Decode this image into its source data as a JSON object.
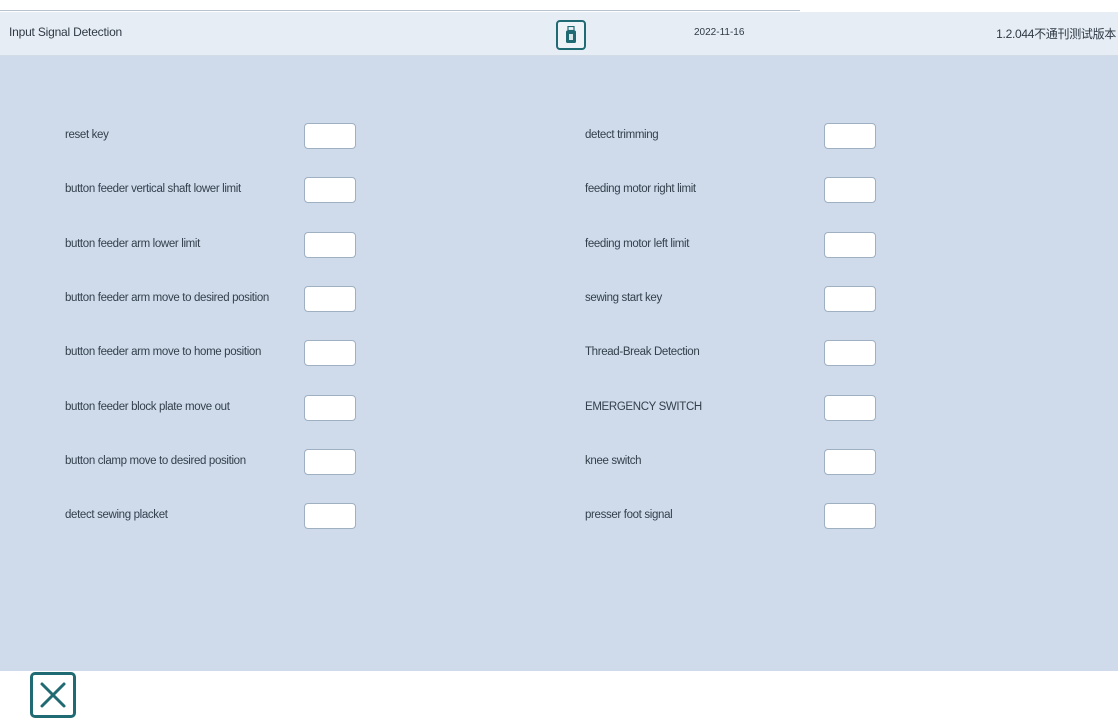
{
  "header": {
    "title": "Input Signal Detection",
    "date": "2022-11-16",
    "version": "1.2.044不通刊测试版本"
  },
  "signals": {
    "left": [
      {
        "label": "reset key",
        "value": ""
      },
      {
        "label": "button feeder vertical shaft lower limit",
        "value": ""
      },
      {
        "label": "button feeder arm lower limit",
        "value": ""
      },
      {
        "label": "button feeder arm move to desired position",
        "value": ""
      },
      {
        "label": "button feeder arm move to home position",
        "value": ""
      },
      {
        "label": "button feeder block plate move out",
        "value": ""
      },
      {
        "label": "button clamp move to desired position",
        "value": ""
      },
      {
        "label": "detect sewing placket",
        "value": ""
      }
    ],
    "right": [
      {
        "label": "detect trimming",
        "value": ""
      },
      {
        "label": "feeding motor right limit",
        "value": ""
      },
      {
        "label": "feeding motor left limit",
        "value": ""
      },
      {
        "label": "sewing start key",
        "value": ""
      },
      {
        "label": "Thread-Break Detection",
        "value": ""
      },
      {
        "label": "EMERGENCY SWITCH",
        "value": ""
      },
      {
        "label": "knee switch",
        "value": ""
      },
      {
        "label": "presser foot signal",
        "value": ""
      }
    ]
  },
  "icons": {
    "usb": "usb-drive-icon",
    "close": "close-icon"
  },
  "colors": {
    "accent": "#1f6a73",
    "background": "#cfdbea",
    "header": "#e7edf4"
  }
}
